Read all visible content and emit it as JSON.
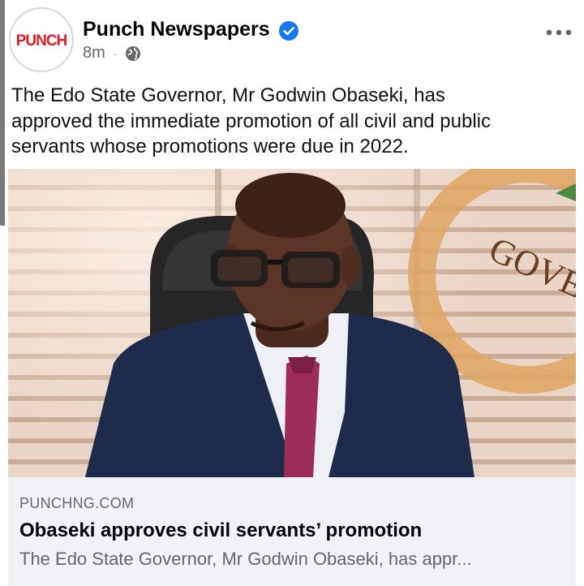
{
  "post": {
    "page_name": "Punch Newspapers",
    "avatar_logo_text": "PUNCH",
    "time_ago": "8m",
    "separator": "·",
    "privacy_icon": "globe-icon",
    "verified_icon": "verified-badge-icon",
    "menu_icon": "more-horizontal-icon",
    "text_lines": [
      "The Edo State Governor, Mr Godwin Obaseki, has",
      "approved the immediate promotion of all civil and public",
      "servants whose promotions were due in 2022."
    ],
    "photo_text": "GOVE"
  },
  "link_preview": {
    "domain": "PUNCHNG.COM",
    "title": "Obaseki approves civil servants’ promotion",
    "description": "The Edo State Governor, Mr Godwin Obaseki, has appr..."
  },
  "colors": {
    "brand_red": "#e21c23",
    "verified_blue": "#1877f2",
    "secondary_text": "#65676b",
    "card_bg": "#f0f2f5"
  }
}
